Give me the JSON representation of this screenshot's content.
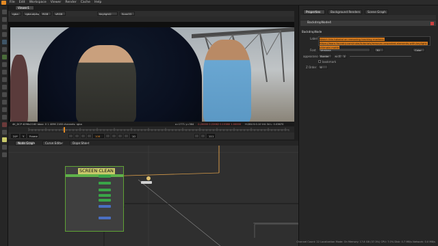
{
  "menu": [
    "File",
    "Edit",
    "Workspace",
    "Viewer",
    "Render",
    "Cache",
    "Help"
  ],
  "viewer": {
    "tab": "Viewer1",
    "channel": "rgba",
    "alpha": "rgba.alpha",
    "colorspace": "RGB",
    "input_space": "sRGB",
    "node_a": "Keylight2",
    "node_b": "Scan33",
    "format_info": "4K_DCP 4096x2160  bbox: 0 1 4096 2160  channels: rgba",
    "coords": "x=1771 y=364",
    "pixel_values": "0.20000  0.22062  0.15380  1.00000",
    "hsvl": "H:284 S:0.10 V:0.34  L: 0.03670"
  },
  "transport": {
    "fps": "24*",
    "frame": "106",
    "end_frame": "10",
    "in_label": "Y",
    "out_label": "10",
    "mode": "Frame",
    "total": "111"
  },
  "nodegraph": {
    "tabs": [
      "Node Graph",
      "Curve Editor",
      "Dope Sheet"
    ],
    "backdrop_label": "SCREEN CLEAN"
  },
  "properties": {
    "tabs": [
      "Properties",
      "Background Renders",
      "Scene Graph"
    ],
    "node_name": "BackdropNode4",
    "section": "BackdropNode",
    "label_field": "Label",
    "label_text": "Watch this tutorial on removing tracking markers: https://learn.foundry.com/nuke/tutorials/remove-unwanted-elements-with-keylight-ultimate-matte",
    "font_label": "Font",
    "font_value": "Verdana",
    "font_size": "30",
    "color_btn": "Color",
    "appearance_label": "appearance",
    "appearance_value": "Border",
    "width_label": "width",
    "width_value": "1",
    "bookmark_label": "bookmark",
    "zorder_label": "Z Order",
    "zorder_value": "0"
  },
  "status": "Channel Count: 22  Localization Mode: On  Memory: 17.8 GB (37.3%)  CPU: 7.0%  Disk: 0.7 MB/s  Network: 0.0 MB/s",
  "colors": {
    "backdrop_border": "#5fa335",
    "backdrop_label_bg": "#c9c96a",
    "label_highlight": "#d2791f",
    "playhead": "#e38a24"
  }
}
